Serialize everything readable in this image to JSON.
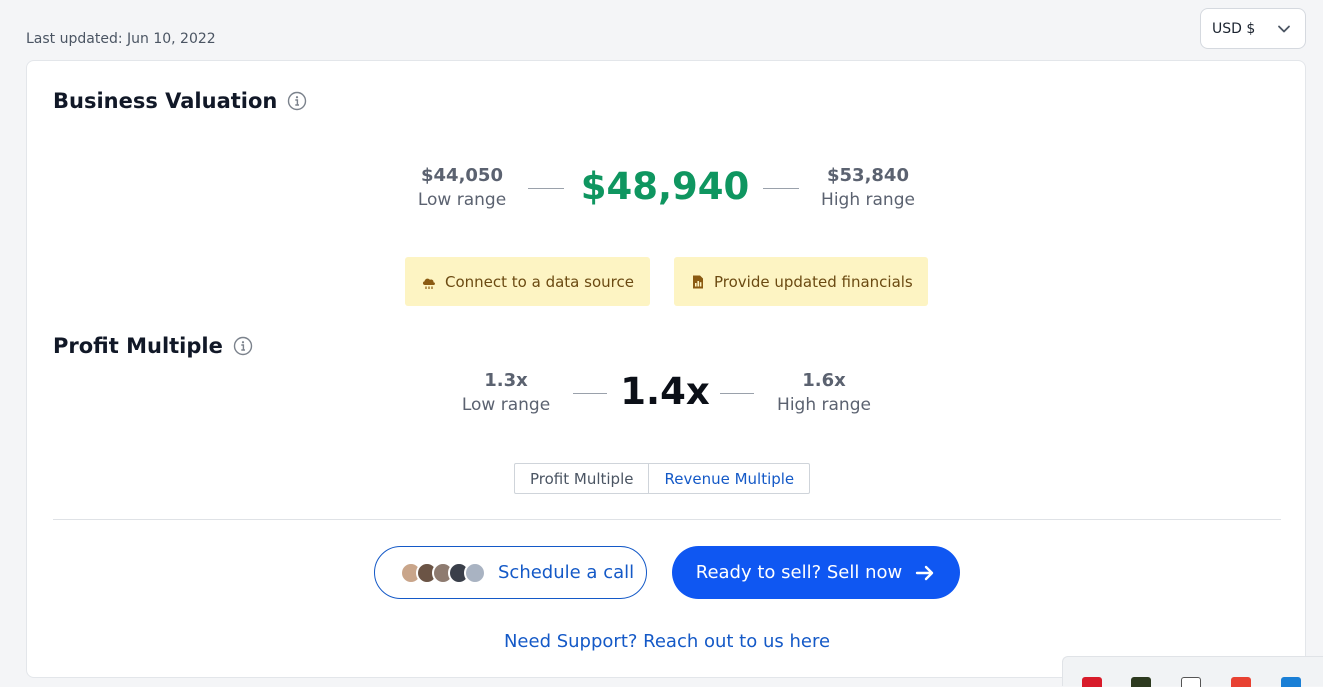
{
  "header": {
    "last_updated": "Last updated: Jun 10, 2022",
    "currency_label": "USD $"
  },
  "business_valuation": {
    "title": "Business Valuation",
    "low_value": "$44,050",
    "low_label": "Low range",
    "main_value": "$48,940",
    "high_value": "$53,840",
    "high_label": "High range",
    "main_color": "#0f9660"
  },
  "actions": {
    "connect_label": "Connect to a data source",
    "financials_label": "Provide updated financials"
  },
  "profit_multiple": {
    "title": "Profit Multiple",
    "low_value": "1.3x",
    "low_label": "Low range",
    "main_value": "1.4x",
    "high_value": "1.6x",
    "high_label": "High range"
  },
  "toggle": {
    "options": [
      "Profit Multiple",
      "Revenue Multiple"
    ]
  },
  "cta": {
    "schedule_label": "Schedule a call",
    "sell_label": "Ready to sell? Sell now",
    "support_label": "Need Support? Reach out to us here"
  },
  "colors": {
    "accent": "#0f57f2",
    "link": "#1459c7",
    "chip_bg": "#fdf4c3"
  }
}
